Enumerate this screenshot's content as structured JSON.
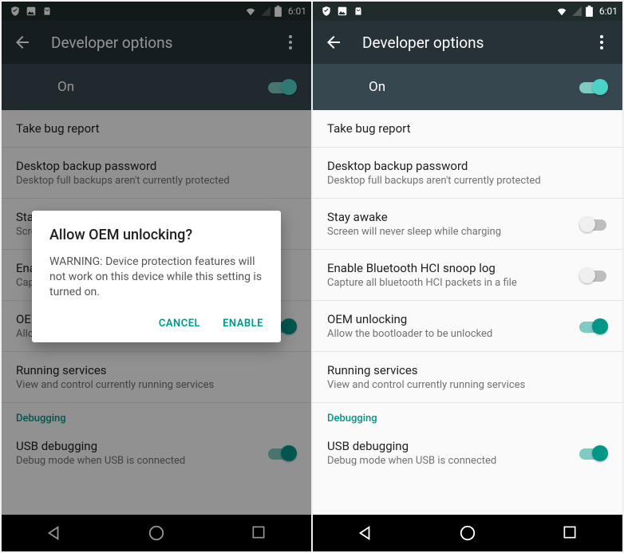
{
  "status": {
    "time": "6:01"
  },
  "appbar": {
    "title": "Developer options"
  },
  "on_row": {
    "label": "On",
    "on": true
  },
  "rows": {
    "bug_report": {
      "title": "Take bug report"
    },
    "backup": {
      "title": "Desktop backup password",
      "sub": "Desktop full backups aren't currently protected"
    },
    "stay_awake": {
      "title": "Stay awake",
      "sub": "Screen will never sleep while charging",
      "on": false
    },
    "bt_hci": {
      "title": "Enable Bluetooth HCI snoop log",
      "sub": "Capture all bluetooth HCI packets in a file",
      "on": false
    },
    "oem": {
      "title": "OEM unlocking",
      "sub": "Allow the bootloader to be unlocked",
      "on": true
    },
    "running": {
      "title": "Running services",
      "sub": "View and control currently running services"
    },
    "usb_debug": {
      "title": "USB debugging",
      "sub": "Debug mode when USB is connected",
      "on": true
    }
  },
  "section": {
    "debugging": "Debugging"
  },
  "dialog": {
    "title": "Allow OEM unlocking?",
    "body": "WARNING: Device protection features will not work on this device while this setting is turned on.",
    "cancel": "Cancel",
    "enable": "Enable"
  }
}
